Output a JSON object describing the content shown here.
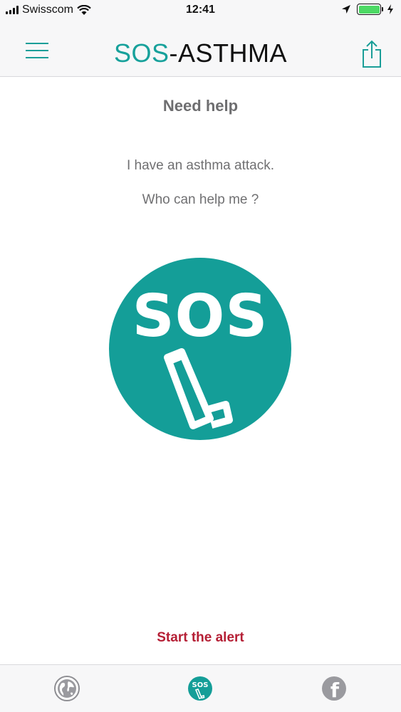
{
  "status_bar": {
    "carrier": "Swisscom",
    "time": "12:41",
    "icons": [
      "signal-icon",
      "wifi-icon",
      "location-icon",
      "battery-icon",
      "charging-icon"
    ]
  },
  "nav": {
    "title_accent": "SOS",
    "title_rest": "-ASTHMA",
    "menu_icon": "hamburger-icon",
    "share_icon": "share-icon"
  },
  "content": {
    "heading": "Need help",
    "line1": "I have an asthma attack.",
    "line2": "Who can help me ?",
    "sos_label": "SOS",
    "alert_label": "Start the alert"
  },
  "tabs": [
    {
      "icon": "globe-icon"
    },
    {
      "icon": "sos-inhaler-icon",
      "label": "SOS"
    },
    {
      "icon": "facebook-icon",
      "label": "f"
    }
  ],
  "colors": {
    "accent": "#17a19b",
    "alert": "#b51f35",
    "text_gray": "#707072",
    "bar_bg": "#f7f7f8",
    "battery": "#4cd964"
  }
}
